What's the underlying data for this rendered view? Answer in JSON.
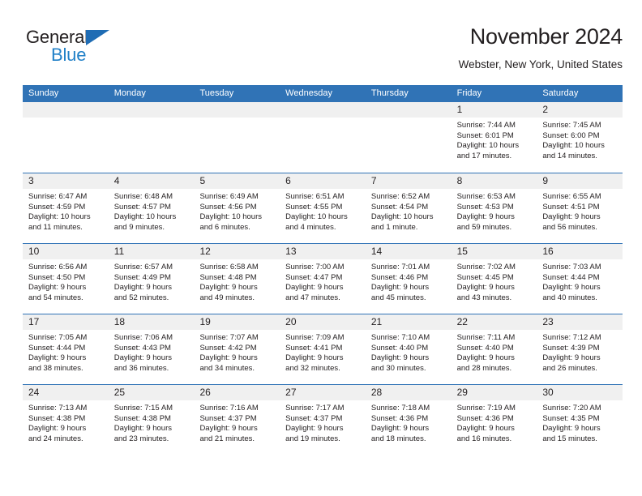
{
  "brand": {
    "name_part1": "General",
    "name_part2": "Blue",
    "triangle_icon": "triangle-icon",
    "color_dark": "#231f20",
    "color_blue": "#2281c8"
  },
  "header": {
    "title": "November 2024",
    "subtitle": "Webster, New York, United States"
  },
  "theme": {
    "header_blue": "#3073b6",
    "day_band_gray": "#f0f0f0",
    "text": "#231f20"
  },
  "weekdays": [
    "Sunday",
    "Monday",
    "Tuesday",
    "Wednesday",
    "Thursday",
    "Friday",
    "Saturday"
  ],
  "weeks": [
    [
      {
        "day": "",
        "sunrise": "",
        "sunset": "",
        "daylight_line1": "",
        "daylight_line2": ""
      },
      {
        "day": "",
        "sunrise": "",
        "sunset": "",
        "daylight_line1": "",
        "daylight_line2": ""
      },
      {
        "day": "",
        "sunrise": "",
        "sunset": "",
        "daylight_line1": "",
        "daylight_line2": ""
      },
      {
        "day": "",
        "sunrise": "",
        "sunset": "",
        "daylight_line1": "",
        "daylight_line2": ""
      },
      {
        "day": "",
        "sunrise": "",
        "sunset": "",
        "daylight_line1": "",
        "daylight_line2": ""
      },
      {
        "day": "1",
        "sunrise": "Sunrise: 7:44 AM",
        "sunset": "Sunset: 6:01 PM",
        "daylight_line1": "Daylight: 10 hours",
        "daylight_line2": "and 17 minutes."
      },
      {
        "day": "2",
        "sunrise": "Sunrise: 7:45 AM",
        "sunset": "Sunset: 6:00 PM",
        "daylight_line1": "Daylight: 10 hours",
        "daylight_line2": "and 14 minutes."
      }
    ],
    [
      {
        "day": "3",
        "sunrise": "Sunrise: 6:47 AM",
        "sunset": "Sunset: 4:59 PM",
        "daylight_line1": "Daylight: 10 hours",
        "daylight_line2": "and 11 minutes."
      },
      {
        "day": "4",
        "sunrise": "Sunrise: 6:48 AM",
        "sunset": "Sunset: 4:57 PM",
        "daylight_line1": "Daylight: 10 hours",
        "daylight_line2": "and 9 minutes."
      },
      {
        "day": "5",
        "sunrise": "Sunrise: 6:49 AM",
        "sunset": "Sunset: 4:56 PM",
        "daylight_line1": "Daylight: 10 hours",
        "daylight_line2": "and 6 minutes."
      },
      {
        "day": "6",
        "sunrise": "Sunrise: 6:51 AM",
        "sunset": "Sunset: 4:55 PM",
        "daylight_line1": "Daylight: 10 hours",
        "daylight_line2": "and 4 minutes."
      },
      {
        "day": "7",
        "sunrise": "Sunrise: 6:52 AM",
        "sunset": "Sunset: 4:54 PM",
        "daylight_line1": "Daylight: 10 hours",
        "daylight_line2": "and 1 minute."
      },
      {
        "day": "8",
        "sunrise": "Sunrise: 6:53 AM",
        "sunset": "Sunset: 4:53 PM",
        "daylight_line1": "Daylight: 9 hours",
        "daylight_line2": "and 59 minutes."
      },
      {
        "day": "9",
        "sunrise": "Sunrise: 6:55 AM",
        "sunset": "Sunset: 4:51 PM",
        "daylight_line1": "Daylight: 9 hours",
        "daylight_line2": "and 56 minutes."
      }
    ],
    [
      {
        "day": "10",
        "sunrise": "Sunrise: 6:56 AM",
        "sunset": "Sunset: 4:50 PM",
        "daylight_line1": "Daylight: 9 hours",
        "daylight_line2": "and 54 minutes."
      },
      {
        "day": "11",
        "sunrise": "Sunrise: 6:57 AM",
        "sunset": "Sunset: 4:49 PM",
        "daylight_line1": "Daylight: 9 hours",
        "daylight_line2": "and 52 minutes."
      },
      {
        "day": "12",
        "sunrise": "Sunrise: 6:58 AM",
        "sunset": "Sunset: 4:48 PM",
        "daylight_line1": "Daylight: 9 hours",
        "daylight_line2": "and 49 minutes."
      },
      {
        "day": "13",
        "sunrise": "Sunrise: 7:00 AM",
        "sunset": "Sunset: 4:47 PM",
        "daylight_line1": "Daylight: 9 hours",
        "daylight_line2": "and 47 minutes."
      },
      {
        "day": "14",
        "sunrise": "Sunrise: 7:01 AM",
        "sunset": "Sunset: 4:46 PM",
        "daylight_line1": "Daylight: 9 hours",
        "daylight_line2": "and 45 minutes."
      },
      {
        "day": "15",
        "sunrise": "Sunrise: 7:02 AM",
        "sunset": "Sunset: 4:45 PM",
        "daylight_line1": "Daylight: 9 hours",
        "daylight_line2": "and 43 minutes."
      },
      {
        "day": "16",
        "sunrise": "Sunrise: 7:03 AM",
        "sunset": "Sunset: 4:44 PM",
        "daylight_line1": "Daylight: 9 hours",
        "daylight_line2": "and 40 minutes."
      }
    ],
    [
      {
        "day": "17",
        "sunrise": "Sunrise: 7:05 AM",
        "sunset": "Sunset: 4:44 PM",
        "daylight_line1": "Daylight: 9 hours",
        "daylight_line2": "and 38 minutes."
      },
      {
        "day": "18",
        "sunrise": "Sunrise: 7:06 AM",
        "sunset": "Sunset: 4:43 PM",
        "daylight_line1": "Daylight: 9 hours",
        "daylight_line2": "and 36 minutes."
      },
      {
        "day": "19",
        "sunrise": "Sunrise: 7:07 AM",
        "sunset": "Sunset: 4:42 PM",
        "daylight_line1": "Daylight: 9 hours",
        "daylight_line2": "and 34 minutes."
      },
      {
        "day": "20",
        "sunrise": "Sunrise: 7:09 AM",
        "sunset": "Sunset: 4:41 PM",
        "daylight_line1": "Daylight: 9 hours",
        "daylight_line2": "and 32 minutes."
      },
      {
        "day": "21",
        "sunrise": "Sunrise: 7:10 AM",
        "sunset": "Sunset: 4:40 PM",
        "daylight_line1": "Daylight: 9 hours",
        "daylight_line2": "and 30 minutes."
      },
      {
        "day": "22",
        "sunrise": "Sunrise: 7:11 AM",
        "sunset": "Sunset: 4:40 PM",
        "daylight_line1": "Daylight: 9 hours",
        "daylight_line2": "and 28 minutes."
      },
      {
        "day": "23",
        "sunrise": "Sunrise: 7:12 AM",
        "sunset": "Sunset: 4:39 PM",
        "daylight_line1": "Daylight: 9 hours",
        "daylight_line2": "and 26 minutes."
      }
    ],
    [
      {
        "day": "24",
        "sunrise": "Sunrise: 7:13 AM",
        "sunset": "Sunset: 4:38 PM",
        "daylight_line1": "Daylight: 9 hours",
        "daylight_line2": "and 24 minutes."
      },
      {
        "day": "25",
        "sunrise": "Sunrise: 7:15 AM",
        "sunset": "Sunset: 4:38 PM",
        "daylight_line1": "Daylight: 9 hours",
        "daylight_line2": "and 23 minutes."
      },
      {
        "day": "26",
        "sunrise": "Sunrise: 7:16 AM",
        "sunset": "Sunset: 4:37 PM",
        "daylight_line1": "Daylight: 9 hours",
        "daylight_line2": "and 21 minutes."
      },
      {
        "day": "27",
        "sunrise": "Sunrise: 7:17 AM",
        "sunset": "Sunset: 4:37 PM",
        "daylight_line1": "Daylight: 9 hours",
        "daylight_line2": "and 19 minutes."
      },
      {
        "day": "28",
        "sunrise": "Sunrise: 7:18 AM",
        "sunset": "Sunset: 4:36 PM",
        "daylight_line1": "Daylight: 9 hours",
        "daylight_line2": "and 18 minutes."
      },
      {
        "day": "29",
        "sunrise": "Sunrise: 7:19 AM",
        "sunset": "Sunset: 4:36 PM",
        "daylight_line1": "Daylight: 9 hours",
        "daylight_line2": "and 16 minutes."
      },
      {
        "day": "30",
        "sunrise": "Sunrise: 7:20 AM",
        "sunset": "Sunset: 4:35 PM",
        "daylight_line1": "Daylight: 9 hours",
        "daylight_line2": "and 15 minutes."
      }
    ]
  ]
}
